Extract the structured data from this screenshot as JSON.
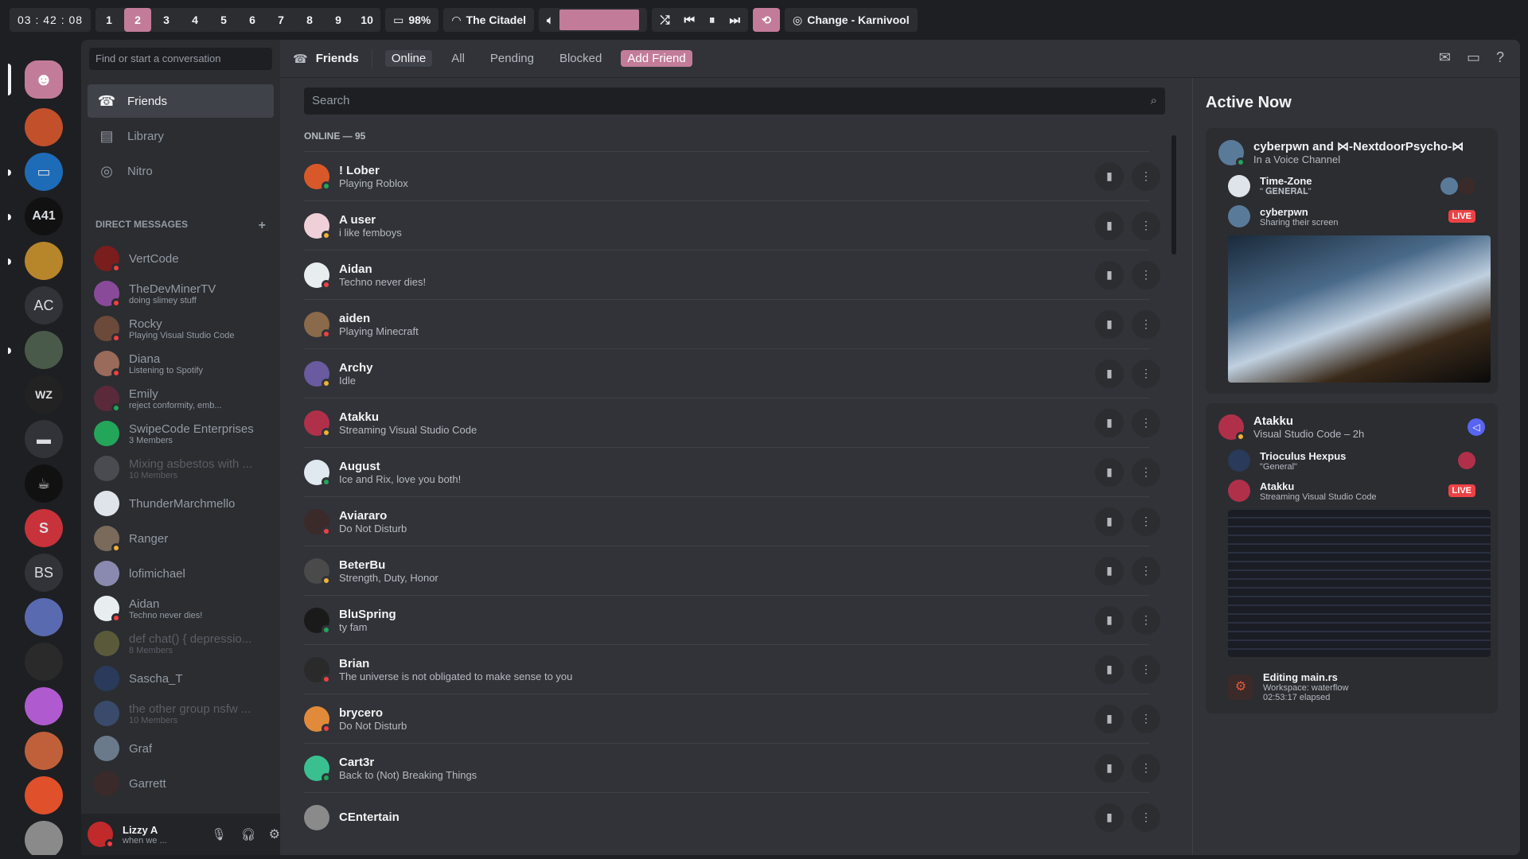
{
  "topbar": {
    "clock": [
      "03",
      "42",
      "08"
    ],
    "workspaces": [
      "1",
      "2",
      "3",
      "4",
      "5",
      "6",
      "7",
      "8",
      "9",
      "10"
    ],
    "active_workspace": 1,
    "battery": "98%",
    "wifi": "The Citadel",
    "now_playing_title": "Change",
    "now_playing_artist": "Karnivool",
    "volume": 1.0
  },
  "colors": {
    "accent": "#c27c99",
    "online": "#23a55a",
    "dnd": "#f23f43",
    "idle": "#f0b232",
    "live": "#ed4245"
  },
  "guild_initials": [
    "AC",
    "BS"
  ],
  "dm_sidebar": {
    "search_placeholder": "Find or start a conversation",
    "nav": [
      "Friends",
      "Library",
      "Nitro"
    ],
    "header": "DIRECT MESSAGES",
    "items": [
      {
        "name": "VertCode",
        "sub": "",
        "status": "dnd",
        "color": "#7a1d1d"
      },
      {
        "name": "TheDevMinerTV",
        "sub": "doing slimey stuff",
        "status": "dnd",
        "color": "#8a4a9a"
      },
      {
        "name": "Rocky",
        "sub": "Playing Visual Studio Code",
        "status": "dnd",
        "color": "#6b4a3a"
      },
      {
        "name": "Diana",
        "sub": "Listening to Spotify",
        "status": "dnd",
        "color": "#9a6a5a"
      },
      {
        "name": "Emily",
        "sub": "reject conformity, emb...",
        "status": "online",
        "color": "#5a2a3a"
      },
      {
        "name": "SwipeCode Enterprises",
        "sub": "3 Members",
        "status": "",
        "color": "#23a55a"
      },
      {
        "name": "Mixing asbestos with ...",
        "sub": "10 Members",
        "status": "",
        "color": "#4a4b50",
        "dim": true
      },
      {
        "name": "ThunderMarchmello",
        "sub": "",
        "status": "",
        "color": "#dfe3ea"
      },
      {
        "name": "Ranger",
        "sub": "",
        "status": "idle",
        "color": "#7a6a5a"
      },
      {
        "name": "lofimichael",
        "sub": "",
        "status": "",
        "color": "#8a8ab0"
      },
      {
        "name": "Aidan",
        "sub": "Techno never dies!",
        "status": "dnd",
        "color": "#e8eef0"
      },
      {
        "name": "def chat() { depressio...",
        "sub": "8 Members",
        "status": "",
        "color": "#5a5a3a",
        "dim": true
      },
      {
        "name": "Sascha_T",
        "sub": "",
        "status": "",
        "color": "#2a3a5a"
      },
      {
        "name": "the other group nsfw ...",
        "sub": "10 Members",
        "status": "",
        "color": "#3a4a6a",
        "dim": true
      },
      {
        "name": "Graf",
        "sub": "",
        "status": "",
        "color": "#6a7a8a"
      },
      {
        "name": "Garrett",
        "sub": "",
        "status": "",
        "color": "#3a2a2a"
      }
    ]
  },
  "user_panel": {
    "name": "Lizzy A",
    "status": "when we ..."
  },
  "friends_header": {
    "title": "Friends",
    "tabs": [
      "Online",
      "All",
      "Pending",
      "Blocked"
    ],
    "add_friend": "Add Friend"
  },
  "friends": {
    "search_placeholder": "Search",
    "count_label": "ONLINE — 95",
    "rows": [
      {
        "name": "! Lober",
        "status_text": "Playing Roblox",
        "status": "online",
        "color": "#d9582a"
      },
      {
        "name": "A user",
        "status_text": "i like femboys",
        "status": "idle",
        "color": "#f0d0d8"
      },
      {
        "name": "Aidan",
        "status_text": "Techno never dies!",
        "status": "dnd",
        "color": "#e8eef0"
      },
      {
        "name": "aiden",
        "status_text": "Playing Minecraft",
        "status": "dnd",
        "color": "#8a6a4a"
      },
      {
        "name": "Archy",
        "status_text": "Idle",
        "status": "idle",
        "color": "#6a5aa0"
      },
      {
        "name": "Atakku",
        "status_text": "Streaming Visual Studio Code",
        "status": "idle",
        "color": "#b0304a"
      },
      {
        "name": "August",
        "status_text": "Ice and Rix, love you both!",
        "status": "online",
        "color": "#e0e8f0"
      },
      {
        "name": "Aviararo",
        "status_text": "Do Not Disturb",
        "status": "dnd",
        "color": "#3a2a2a"
      },
      {
        "name": "BeterBu",
        "status_text": "Strength, Duty, Honor",
        "status": "idle",
        "color": "#4a4a4a"
      },
      {
        "name": "BluSpring",
        "status_text": "ty fam",
        "status": "online",
        "color": "#1a1a1a"
      },
      {
        "name": "Brian",
        "status_text": "The universe is not obligated to make sense to you",
        "status": "dnd",
        "color": "#2a2a2a"
      },
      {
        "name": "brycero",
        "status_text": "Do Not Disturb",
        "status": "dnd",
        "color": "#e08a3a"
      },
      {
        "name": "Cart3r",
        "status_text": "Back to (Not) Breaking Things",
        "status": "online",
        "color": "#3ac090"
      },
      {
        "name": "CEntertain",
        "status_text": "",
        "status": "",
        "color": "#8a8a8a"
      }
    ]
  },
  "active_now": {
    "title": "Active Now",
    "cards": [
      {
        "title": "cyberpwn and ⋈-NextdoorPsycho-⋈",
        "subtitle": "In a Voice Channel",
        "entries": [
          {
            "name": "Time-Zone",
            "detail": "\" 𝐆𝐄𝐍𝐄𝐑𝐀𝐋\"",
            "live": false
          },
          {
            "name": "cyberpwn",
            "detail": "Sharing their screen",
            "live": true
          }
        ]
      },
      {
        "title": "Atakku",
        "subtitle": "Visual Studio Code – 2h",
        "entries": [
          {
            "name": "Trioculus Hexpus",
            "detail": "\"General\"",
            "live": false
          },
          {
            "name": "Atakku",
            "detail": "Streaming Visual Studio Code",
            "live": true
          }
        ],
        "footer": {
          "title": "Editing main.rs",
          "line1": "Workspace: waterflow",
          "line2": "02:53:17 elapsed"
        }
      }
    ],
    "live_label": "LIVE"
  }
}
